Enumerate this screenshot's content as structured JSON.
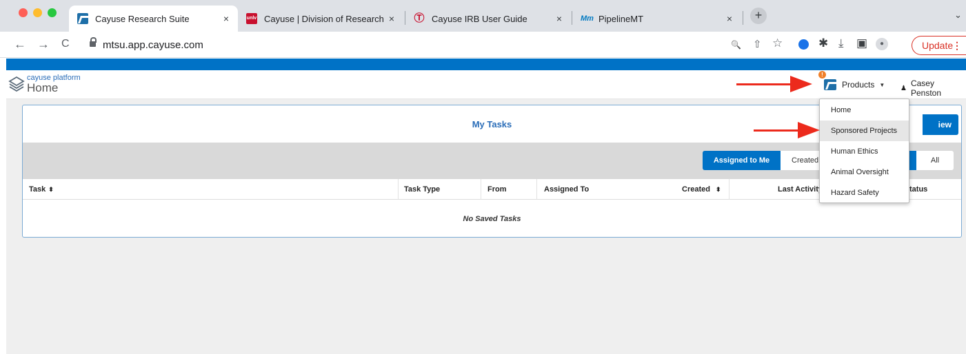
{
  "browser": {
    "tabs": [
      {
        "title": "Cayuse Research Suite",
        "favicon": "cayuse-favicon",
        "active": true
      },
      {
        "title": "Cayuse | Division of Research",
        "favicon": "unlv-favicon",
        "active": false
      },
      {
        "title": "Cayuse IRB User Guide",
        "favicon": "ttu-favicon",
        "active": false
      },
      {
        "title": "PipelineMT",
        "favicon": "mt-favicon",
        "active": false
      }
    ],
    "tab_close": "×",
    "new_tab": "+",
    "tab_menu": "⌄",
    "url": "mtsu.app.cayuse.com",
    "update_label": "Update",
    "update_dots": "⋮",
    "nav": {
      "back": "←",
      "forward": "→",
      "reload": "C"
    },
    "toolbar_icons": {
      "zoom": "🔍",
      "share": "⇧",
      "bookmark": "☆",
      "extensions": "✱",
      "download": "⤓",
      "sidepanel": "▣",
      "profile": "●"
    }
  },
  "app": {
    "platform_label": "cayuse platform",
    "page_heading": "Home",
    "notification_count": "!",
    "products_label": "Products",
    "user_name": "Casey Penston",
    "colors": {
      "brand_blue": "#0072c6",
      "arrow_red": "#ec2a1c",
      "badge_orange": "#f0802a"
    }
  },
  "tasks": {
    "title": "My Tasks",
    "new_task_label": "iew Task",
    "filters": {
      "assigned_to_me": "Assigned to Me",
      "created": "Created",
      "all": "All"
    },
    "columns": {
      "task": "Task",
      "task_type": "Task Type",
      "from": "From",
      "assigned_to": "Assigned To",
      "created": "Created",
      "last_activity": "Last Activity",
      "status": "tatus"
    },
    "sort_glyph": "⬍",
    "empty_message": "No Saved Tasks"
  },
  "products_menu": {
    "items": [
      "Home",
      "Sponsored Projects",
      "Human Ethics",
      "Animal Oversight",
      "Hazard Safety"
    ],
    "hovered": "Sponsored Projects"
  }
}
